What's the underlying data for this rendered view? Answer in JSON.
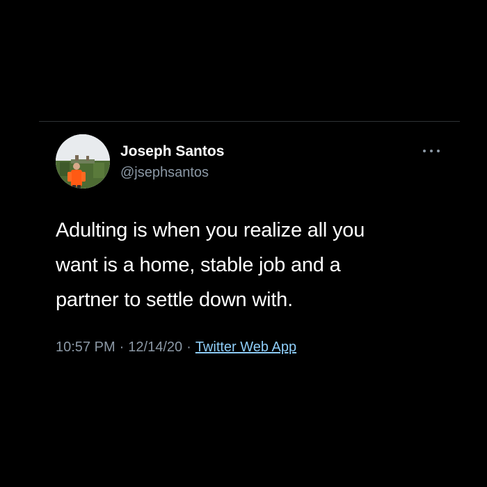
{
  "tweet": {
    "author": {
      "display_name": "Joseph Santos",
      "handle": "@jsephsantos"
    },
    "text_lines": [
      "Adulting is when you realize all you",
      "want is a home, stable job and a",
      "partner to settle down with."
    ],
    "time": "10:57 PM",
    "date": "12/14/20",
    "separator": "·",
    "source": "Twitter Web App",
    "more_icon": "more-horizontal-icon"
  },
  "colors": {
    "background": "#000000",
    "primary_text": "#ffffff",
    "secondary_text": "#8b98a5",
    "link": "#8ecdf8",
    "divider": "#2f3336"
  }
}
